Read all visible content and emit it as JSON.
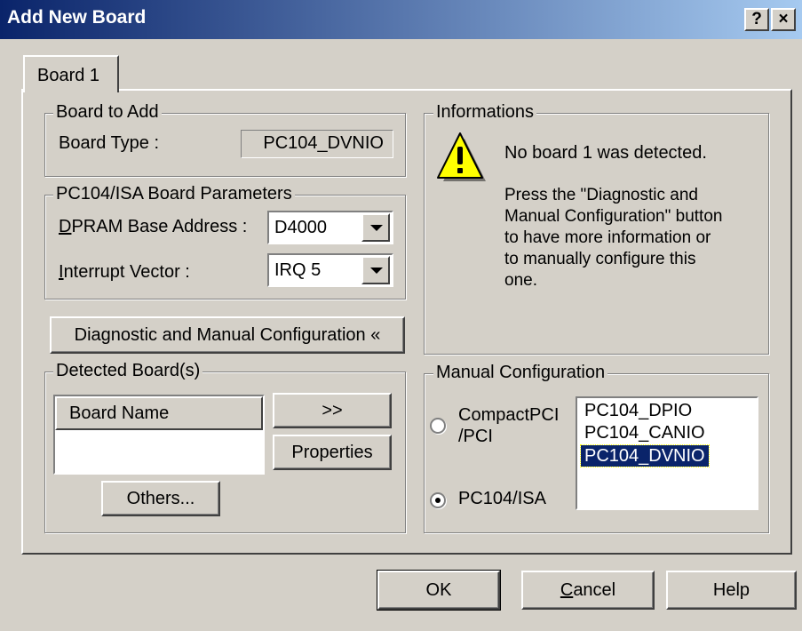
{
  "window": {
    "title": "Add New Board",
    "help_glyph": "?",
    "close_glyph": "×"
  },
  "tabs": [
    {
      "label": "Board 1"
    }
  ],
  "board_to_add": {
    "legend": "Board to Add",
    "type_label": "Board Type :",
    "type_value": "PC104_DVNIO"
  },
  "params": {
    "legend": "PC104/ISA Board Parameters",
    "dpram": {
      "label_mnemonic": "D",
      "label_rest": "PRAM Base Address :",
      "value": "D4000"
    },
    "irq": {
      "label_mnemonic": "I",
      "label_rest": "nterrupt Vector :",
      "value": "IRQ 5"
    }
  },
  "diag_button": "Diagnostic and Manual Configuration «",
  "detected": {
    "legend": "Detected Board(s)",
    "column_header": "Board Name",
    "add_button": ">>",
    "properties_button": "Properties",
    "others_button": "Others..."
  },
  "info": {
    "legend": "Informations",
    "icon": "warning-icon",
    "line1": "No board 1 was detected.",
    "line2": "Press the \"Diagnostic and Manual Configuration\" button to have more information or to manually configure this one."
  },
  "manual": {
    "legend": "Manual Configuration",
    "radio_pci": "CompactPCI /PCI",
    "radio_isa": "PC104/ISA",
    "selected_radio": "PC104/ISA",
    "boards": [
      "PC104_DPIO",
      "PC104_CANIO",
      "PC104_DVNIO"
    ],
    "selected_board": "PC104_DVNIO"
  },
  "footer": {
    "ok": "OK",
    "cancel_mnemonic": "C",
    "cancel_rest": "ancel",
    "help": "Help"
  },
  "colors": {
    "title_start": "#0a246a",
    "title_end": "#a6caf0",
    "face": "#d4d0c8",
    "selection": "#0a246a"
  }
}
